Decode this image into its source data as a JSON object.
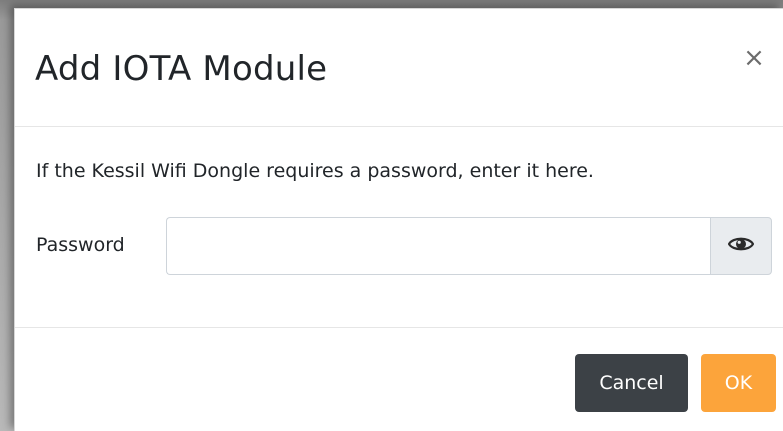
{
  "dialog": {
    "title": "Add IOTA Module",
    "close_label": "×",
    "help_text": "If the Kessil Wifi Dongle requires a password, enter it here.",
    "password": {
      "label": "Password",
      "value": "",
      "placeholder": "",
      "toggle_icon": "eye-icon"
    },
    "buttons": {
      "cancel_label": "Cancel",
      "ok_label": "OK"
    }
  },
  "colors": {
    "cancel_bg": "#3c4146",
    "ok_bg": "#fca43b",
    "addon_bg": "#e9ecef",
    "text": "#212529"
  }
}
